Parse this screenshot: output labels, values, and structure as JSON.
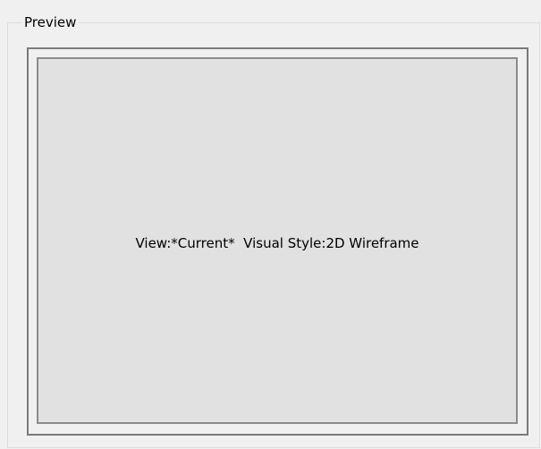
{
  "groupbox": {
    "title": "Preview"
  },
  "preview": {
    "caption": "View:*Current*  Visual Style:2D Wireframe"
  },
  "colors": {
    "window_background": "#f0f0f0",
    "preview_background": "#e1e1e1",
    "frame_border": "#7a7a7a"
  }
}
